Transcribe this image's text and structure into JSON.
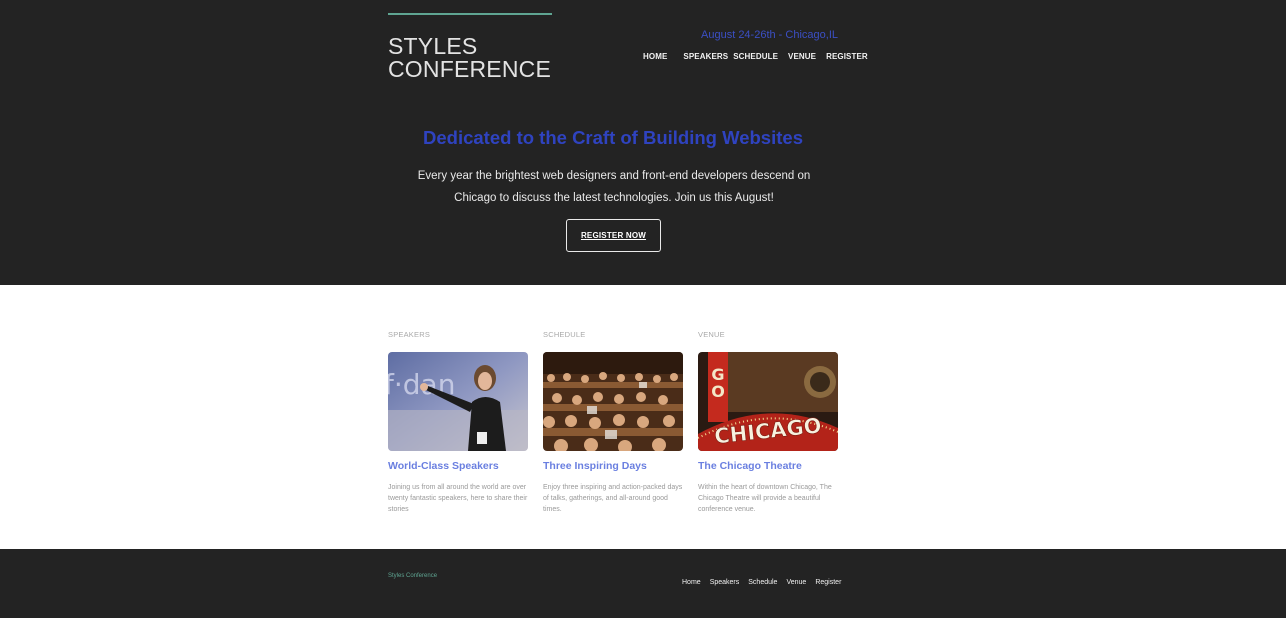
{
  "header": {
    "logo_line1": "STYLES",
    "logo_line2": "CONFERENCE",
    "date_location": "August 24-26th - Chicago,IL",
    "nav": [
      "HOME",
      "SPEAKERS",
      "SCHEDULE",
      "VENUE",
      "REGISTER"
    ]
  },
  "hero": {
    "title": "Dedicated to the Craft of Building Websites",
    "text": "Every year the brightest web designers and front-end developers descend on Chicago to discuss the latest technologies. Join us this August!",
    "button": "REGISTER NOW"
  },
  "cards": [
    {
      "label": "SPEAKERS",
      "title": "World-Class Speakers",
      "desc": "Joining us from all around the world are over twenty fantastic speakers, here to share their stories",
      "image_alt": "Speaker presenting on stage"
    },
    {
      "label": "SCHEDULE",
      "title": "Three Inspiring Days",
      "desc": "Enjoy three inspiring and action-packed days of talks, gatherings, and all-around good times.",
      "image_alt": "Audience at conference"
    },
    {
      "label": "VENUE",
      "title": "The Chicago Theatre",
      "desc": "Within the heart of downtown Chicago, The Chicago Theatre will provide a beautiful conference venue.",
      "image_alt": "Chicago Theatre marquee",
      "image_text": "CHICAGO",
      "image_vertical": "GO"
    }
  ],
  "footer": {
    "brand": "Styles Conference",
    "nav": [
      "Home",
      "Speakers",
      "Schedule",
      "Venue",
      "Register"
    ]
  },
  "colors": {
    "dark_bg": "#232323",
    "accent_teal": "#5fa592",
    "accent_blue": "#2f43c0",
    "link_blue": "#6a7fe0"
  }
}
